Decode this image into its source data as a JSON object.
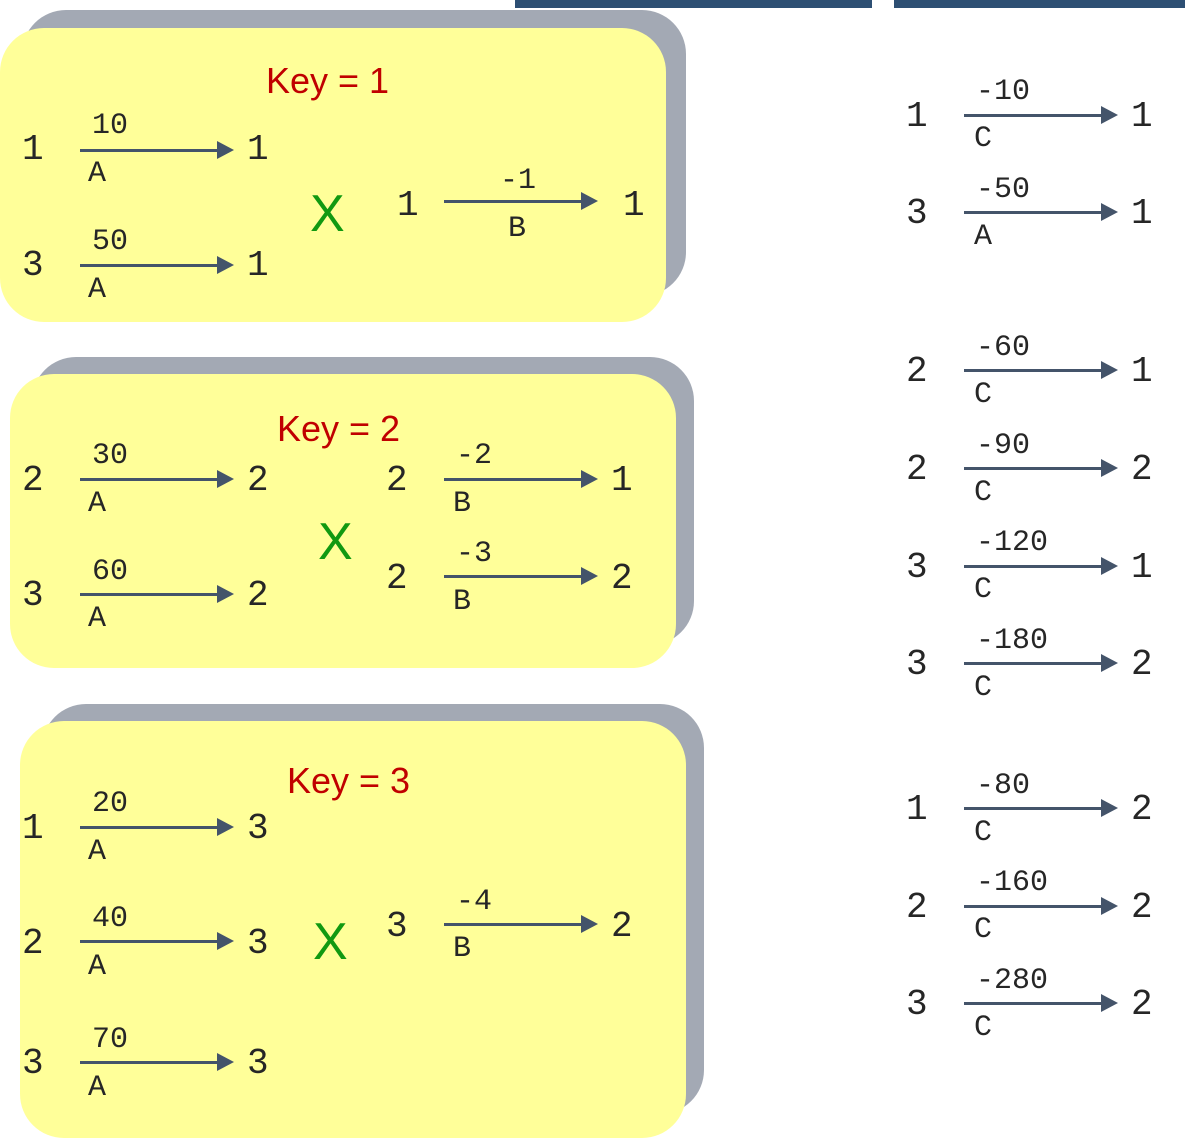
{
  "colors": {
    "panel": "#ffff99",
    "panel_shadow": "#a3a9b4",
    "key": "#c00000",
    "cross": "#119911",
    "arrow": "#44546a",
    "text": "#262626"
  },
  "groups": [
    {
      "key_label": "Key = 1",
      "cross_symbol": "X",
      "left": [
        {
          "src": "1",
          "weight": "10",
          "tag": "A",
          "dst": "1"
        },
        {
          "src": "3",
          "weight": "50",
          "tag": "A",
          "dst": "1"
        }
      ],
      "right": [
        {
          "src": "1",
          "weight": "-1",
          "tag": "B",
          "dst": "1"
        }
      ]
    },
    {
      "key_label": "Key = 2",
      "cross_symbol": "X",
      "left": [
        {
          "src": "2",
          "weight": "30",
          "tag": "A",
          "dst": "2"
        },
        {
          "src": "3",
          "weight": "60",
          "tag": "A",
          "dst": "2"
        }
      ],
      "right": [
        {
          "src": "2",
          "weight": "-2",
          "tag": "B",
          "dst": "1"
        },
        {
          "src": "2",
          "weight": "-3",
          "tag": "B",
          "dst": "2"
        }
      ]
    },
    {
      "key_label": "Key = 3",
      "cross_symbol": "X",
      "left": [
        {
          "src": "1",
          "weight": "20",
          "tag": "A",
          "dst": "3"
        },
        {
          "src": "2",
          "weight": "40",
          "tag": "A",
          "dst": "3"
        },
        {
          "src": "3",
          "weight": "70",
          "tag": "A",
          "dst": "3"
        }
      ],
      "right": [
        {
          "src": "3",
          "weight": "-4",
          "tag": "B",
          "dst": "2"
        }
      ]
    }
  ],
  "results": [
    {
      "src": "1",
      "weight": "-10",
      "tag": "C",
      "dst": "1"
    },
    {
      "src": "3",
      "weight": "-50",
      "tag": "A",
      "dst": "1"
    },
    {
      "src": "2",
      "weight": "-60",
      "tag": "C",
      "dst": "1"
    },
    {
      "src": "2",
      "weight": "-90",
      "tag": "C",
      "dst": "2"
    },
    {
      "src": "3",
      "weight": "-120",
      "tag": "C",
      "dst": "1"
    },
    {
      "src": "3",
      "weight": "-180",
      "tag": "C",
      "dst": "2"
    },
    {
      "src": "1",
      "weight": "-80",
      "tag": "C",
      "dst": "2"
    },
    {
      "src": "2",
      "weight": "-160",
      "tag": "C",
      "dst": "2"
    },
    {
      "src": "3",
      "weight": "-280",
      "tag": "C",
      "dst": "2"
    }
  ]
}
